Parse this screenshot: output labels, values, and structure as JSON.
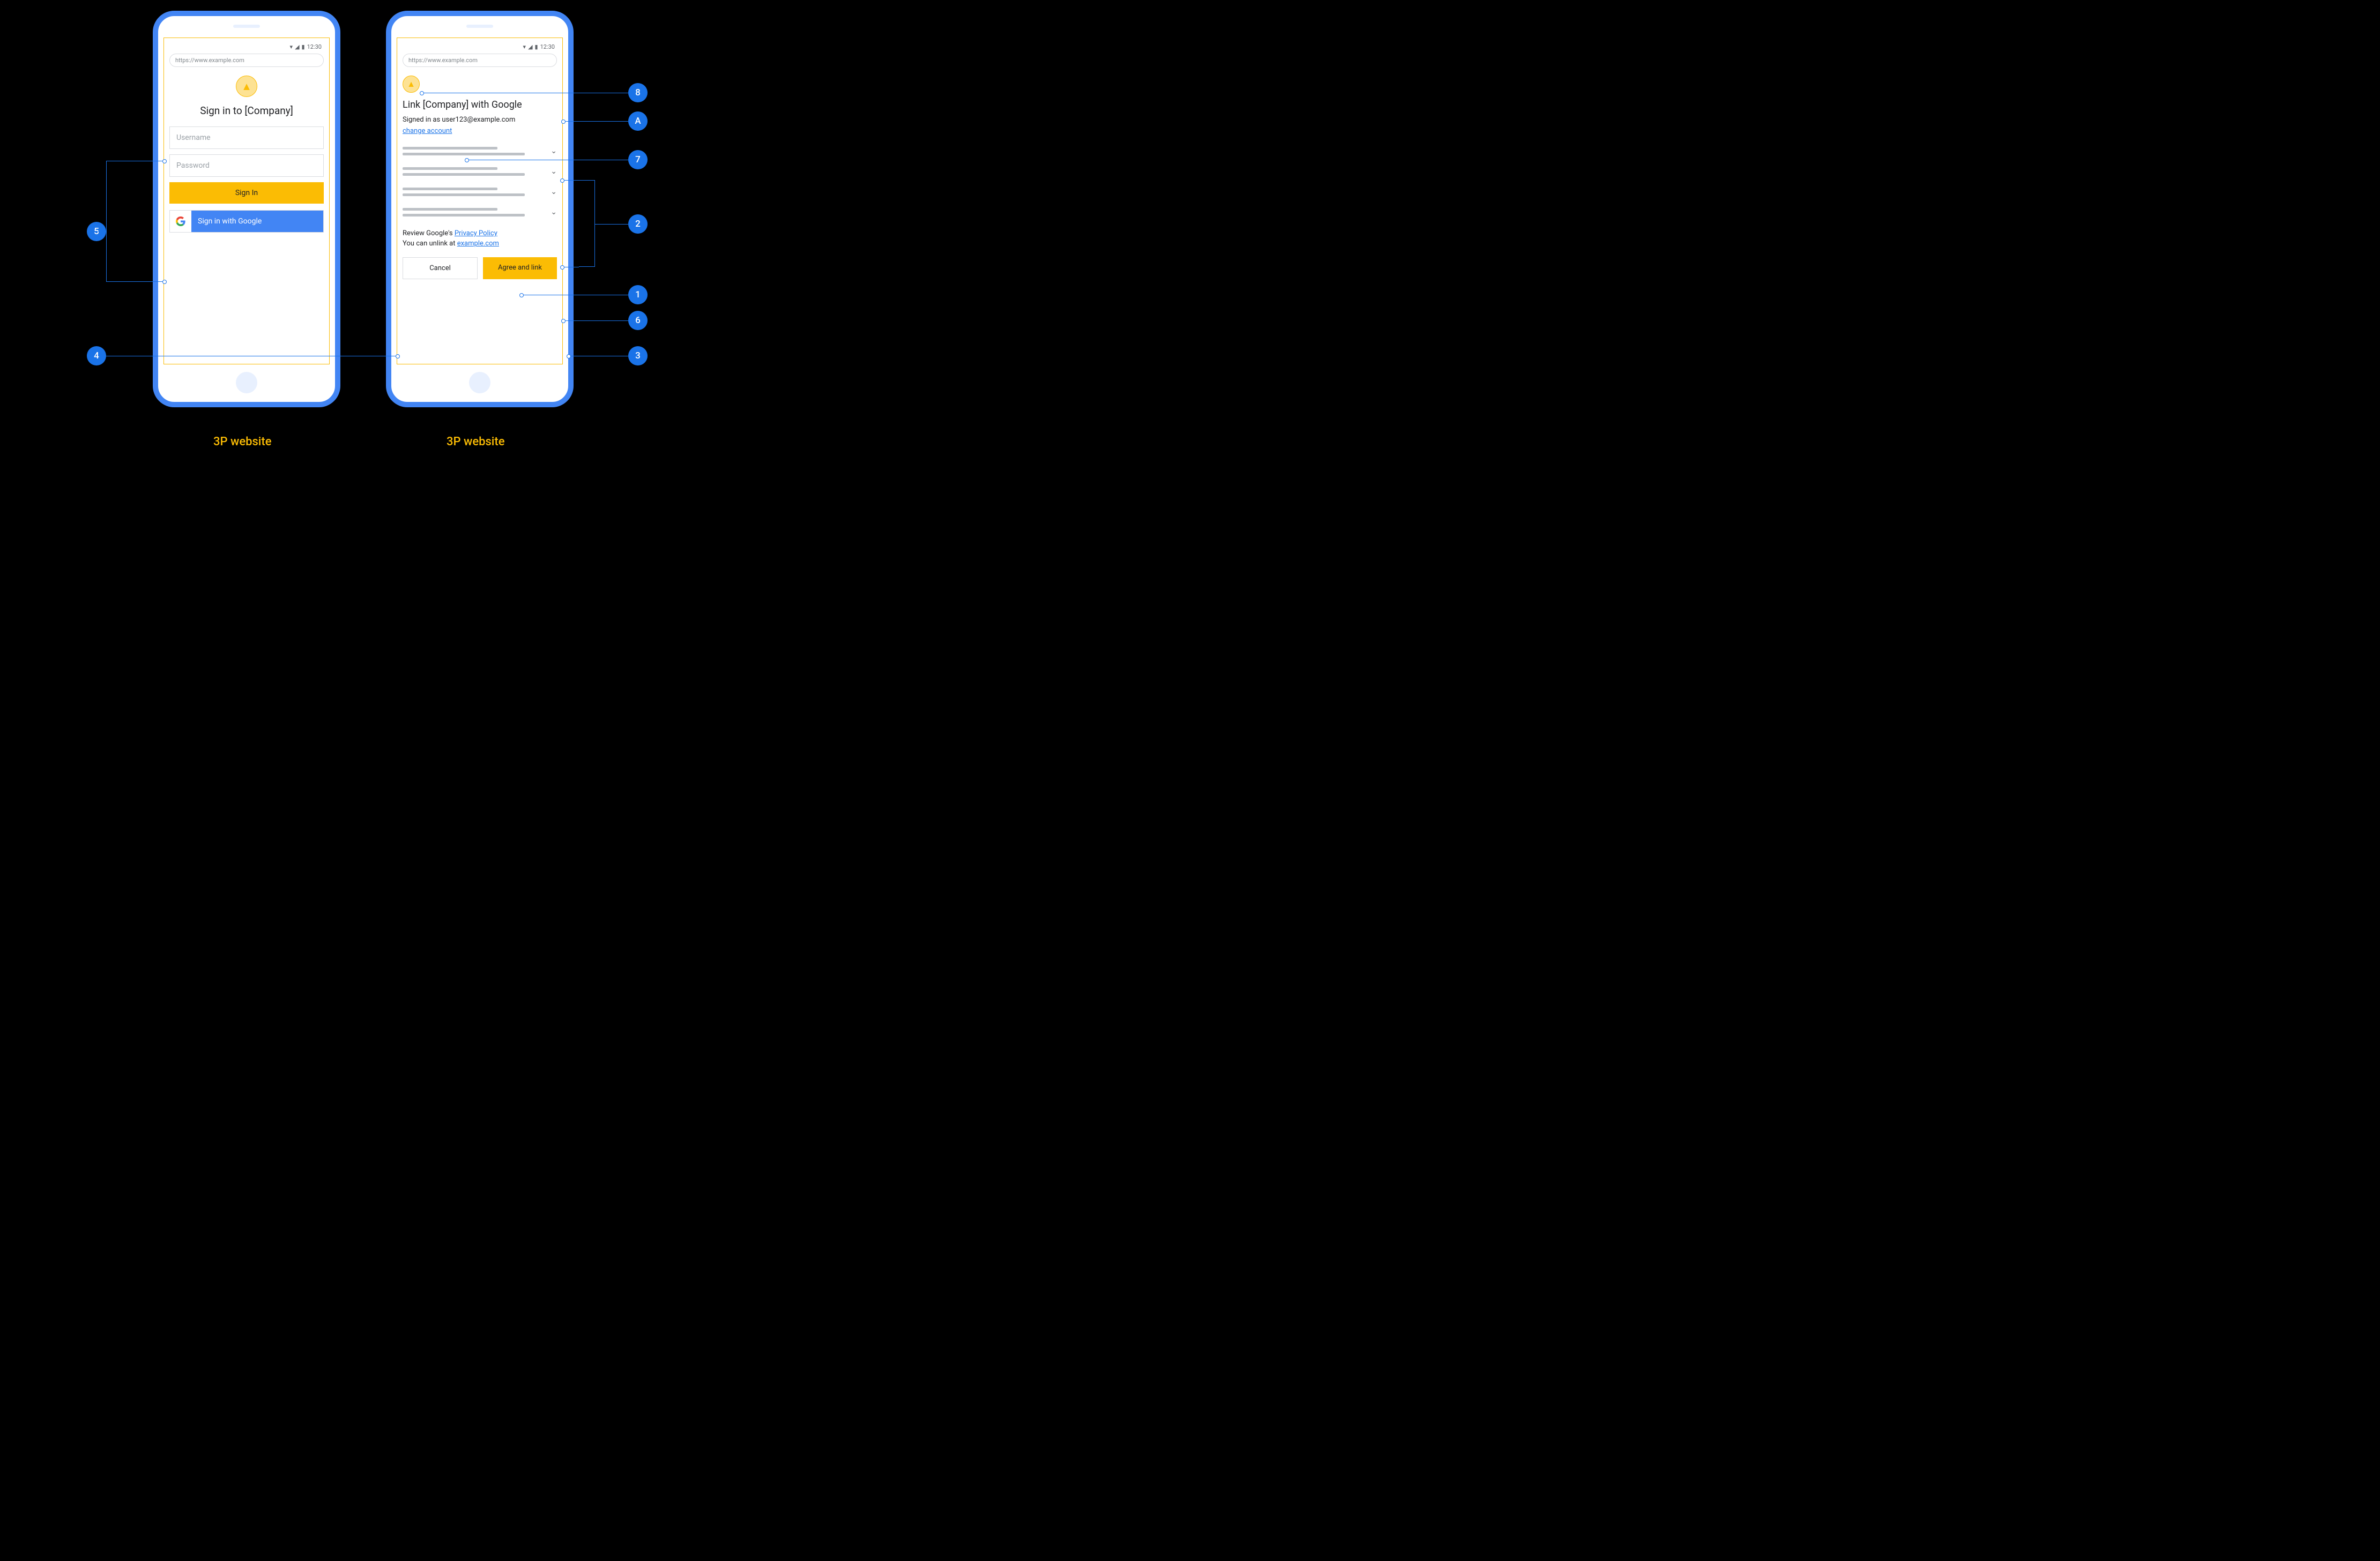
{
  "status": {
    "time": "12:30"
  },
  "url": "https://www.example.com",
  "signin": {
    "title": "Sign in to [Company]",
    "username_ph": "Username",
    "password_ph": "Password",
    "signin_btn": "Sign In",
    "google_btn": "Sign in with Google"
  },
  "consent": {
    "title": "Link [Company] with Google",
    "signed_in_as": "Signed in as user123@example.com",
    "change_account": "change account",
    "review_prefix": "Review Google's ",
    "privacy_policy": "Privacy Policy",
    "unlink_prefix": "You can unlink at ",
    "unlink_domain": "example.com",
    "cancel": "Cancel",
    "agree": "Agree and link"
  },
  "captions": {
    "left": "3P website",
    "right": "3P website"
  },
  "callouts": {
    "c1": "1",
    "c2": "2",
    "c3": "3",
    "c4": "4",
    "c5": "5",
    "c6": "6",
    "c7": "7",
    "c8": "8",
    "cA": "A"
  }
}
